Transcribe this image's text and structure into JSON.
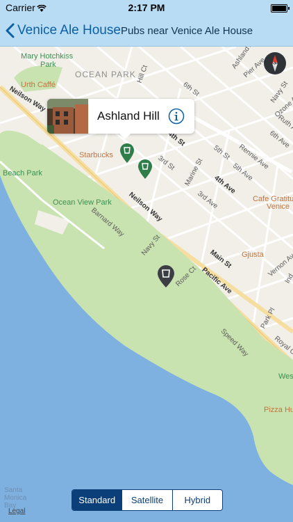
{
  "status_bar": {
    "carrier": "Carrier",
    "time": "2:17 PM",
    "battery_level": 1.0
  },
  "nav": {
    "back_label": "Venice Ale House",
    "title": "Pubs near Venice Ale House"
  },
  "callout": {
    "title": "Ashland Hill"
  },
  "map": {
    "places": [
      {
        "text": "Mary Hotchkiss",
        "kind": "park"
      },
      {
        "text": "Park",
        "kind": "park"
      },
      {
        "text": "OCEAN PARK",
        "kind": "area"
      },
      {
        "text": "Urth Caffé",
        "kind": "poi"
      },
      {
        "text": "Starbucks",
        "kind": "poi"
      },
      {
        "text": "Beach Park",
        "kind": "park"
      },
      {
        "text": "Ocean View Park",
        "kind": "park"
      },
      {
        "text": "Cafe Gratitude",
        "kind": "poi"
      },
      {
        "text": "Venice",
        "kind": "poi"
      },
      {
        "text": "Gjusta",
        "kind": "poi"
      },
      {
        "text": "Pizza Hu",
        "kind": "poi"
      },
      {
        "text": "Wes",
        "kind": "park"
      }
    ],
    "streets": [
      {
        "text": "Neilson Way"
      },
      {
        "text": "Neilson Way"
      },
      {
        "text": "Barnard Way"
      },
      {
        "text": "Hill Ct"
      },
      {
        "text": "6th St"
      },
      {
        "text": "Ashland Av"
      },
      {
        "text": "Pier Ave"
      },
      {
        "text": "Navy St"
      },
      {
        "text": "Ozone Av"
      },
      {
        "text": "Ruth Av"
      },
      {
        "text": "6th Ave"
      },
      {
        "text": "Rennie Ave"
      },
      {
        "text": "5th St"
      },
      {
        "text": "5th Ave"
      },
      {
        "text": "4th St"
      },
      {
        "text": "4th Ave"
      },
      {
        "text": "3rd St"
      },
      {
        "text": "Marine St"
      },
      {
        "text": "3rd Ave"
      },
      {
        "text": "Navy St"
      },
      {
        "text": "Main St"
      },
      {
        "text": "Pacific Ave"
      },
      {
        "text": "Rose Ct"
      },
      {
        "text": "Speed Way"
      },
      {
        "text": "Park Pl"
      },
      {
        "text": "Royal Ct"
      },
      {
        "text": "Vernon Ave"
      },
      {
        "text": "Ind"
      }
    ],
    "water_label": [
      "Santa",
      "Monica",
      "Bay"
    ],
    "compass_letter": "N"
  },
  "map_type": {
    "options": [
      "Standard",
      "Satellite",
      "Hybrid"
    ],
    "selected": "Standard"
  },
  "legal_label": "Legal",
  "colors": {
    "nav": "#b7dcf3",
    "accent": "#0b3f79",
    "water": "#7fb1e0",
    "park": "#c8e3b0",
    "pub_pin": "#2e7d4a",
    "selected_pin": "#3b3f44"
  }
}
